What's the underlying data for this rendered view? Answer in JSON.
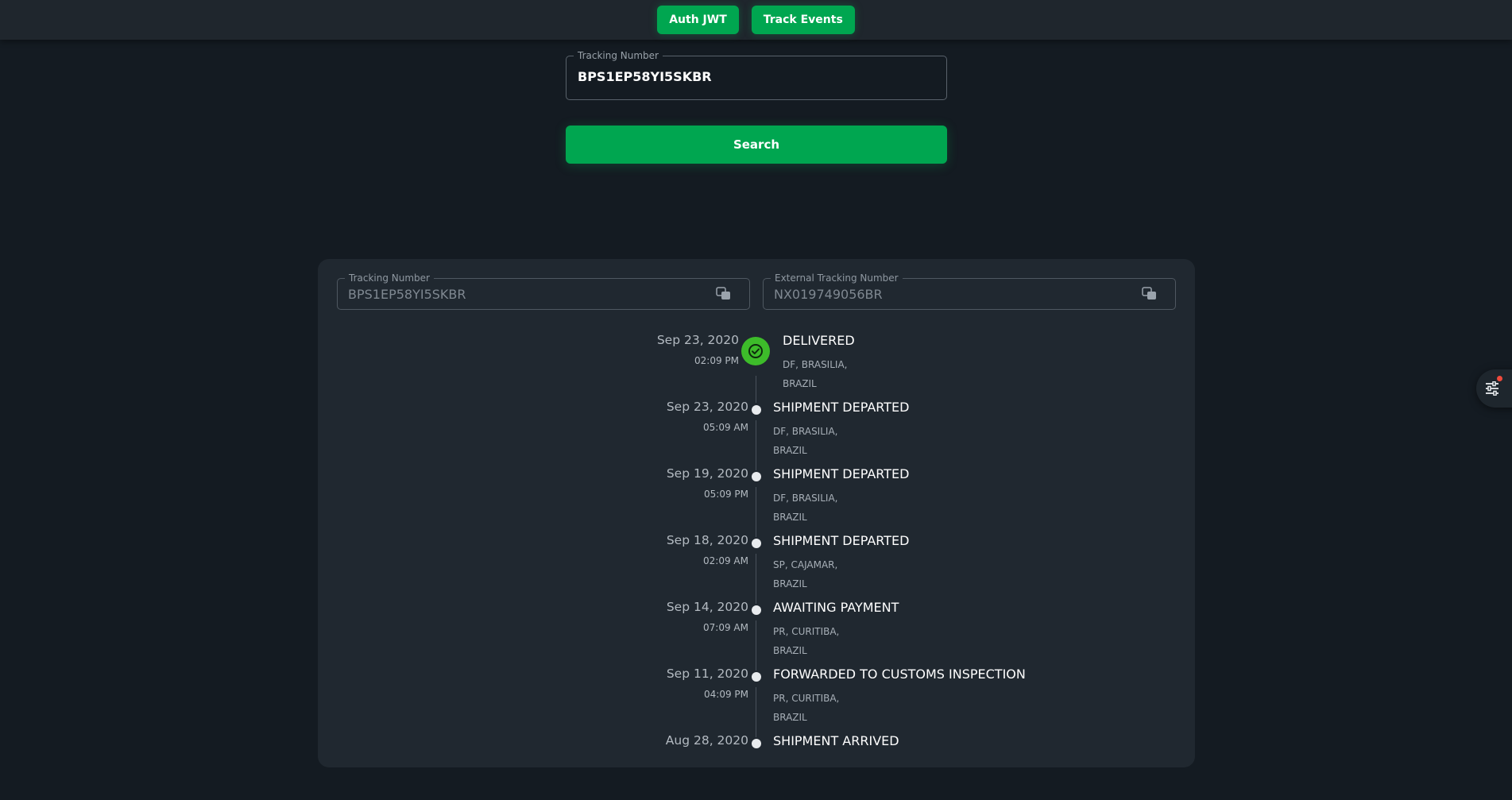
{
  "header": {
    "buttons": [
      {
        "label": "Auth JWT"
      },
      {
        "label": "Track Events"
      }
    ]
  },
  "search": {
    "legend": "Tracking Number",
    "value": "BPS1EP58YI5SKBR",
    "button_label": "Search"
  },
  "details": {
    "tracking": {
      "legend": "Tracking Number",
      "value": "BPS1EP58YI5SKBR"
    },
    "external": {
      "legend": "External Tracking Number",
      "value": "NX019749056BR"
    }
  },
  "events": [
    {
      "date": "Sep 23, 2020",
      "time": "02:09 PM",
      "status": "DELIVERED",
      "loc1": "DF, BRASILIA,",
      "loc2": "BRAZIL"
    },
    {
      "date": "Sep 23, 2020",
      "time": "05:09 AM",
      "status": "SHIPMENT DEPARTED",
      "loc1": "DF, BRASILIA,",
      "loc2": "BRAZIL"
    },
    {
      "date": "Sep 19, 2020",
      "time": "05:09 PM",
      "status": "SHIPMENT DEPARTED",
      "loc1": "DF, BRASILIA,",
      "loc2": "BRAZIL"
    },
    {
      "date": "Sep 18, 2020",
      "time": "02:09 AM",
      "status": "SHIPMENT DEPARTED",
      "loc1": "SP, CAJAMAR,",
      "loc2": "BRAZIL"
    },
    {
      "date": "Sep 14, 2020",
      "time": "07:09 AM",
      "status": "AWAITING PAYMENT",
      "loc1": "PR, CURITIBA,",
      "loc2": "BRAZIL"
    },
    {
      "date": "Sep 11, 2020",
      "time": "04:09 PM",
      "status": "FORWARDED TO CUSTOMS INSPECTION",
      "loc1": "PR, CURITIBA,",
      "loc2": "BRAZIL"
    },
    {
      "date": "Aug 28, 2020",
      "time": "",
      "status": "SHIPMENT ARRIVED",
      "loc1": "",
      "loc2": ""
    }
  ],
  "colors": {
    "accent": "#00a650",
    "delivered": "#3dbc2a",
    "background": "#141b22",
    "card": "#202830",
    "badge": "#f04a3c"
  },
  "icons": {
    "delivered": "check-circle-icon",
    "copy": "copy-icon",
    "settings": "sliders-icon"
  }
}
